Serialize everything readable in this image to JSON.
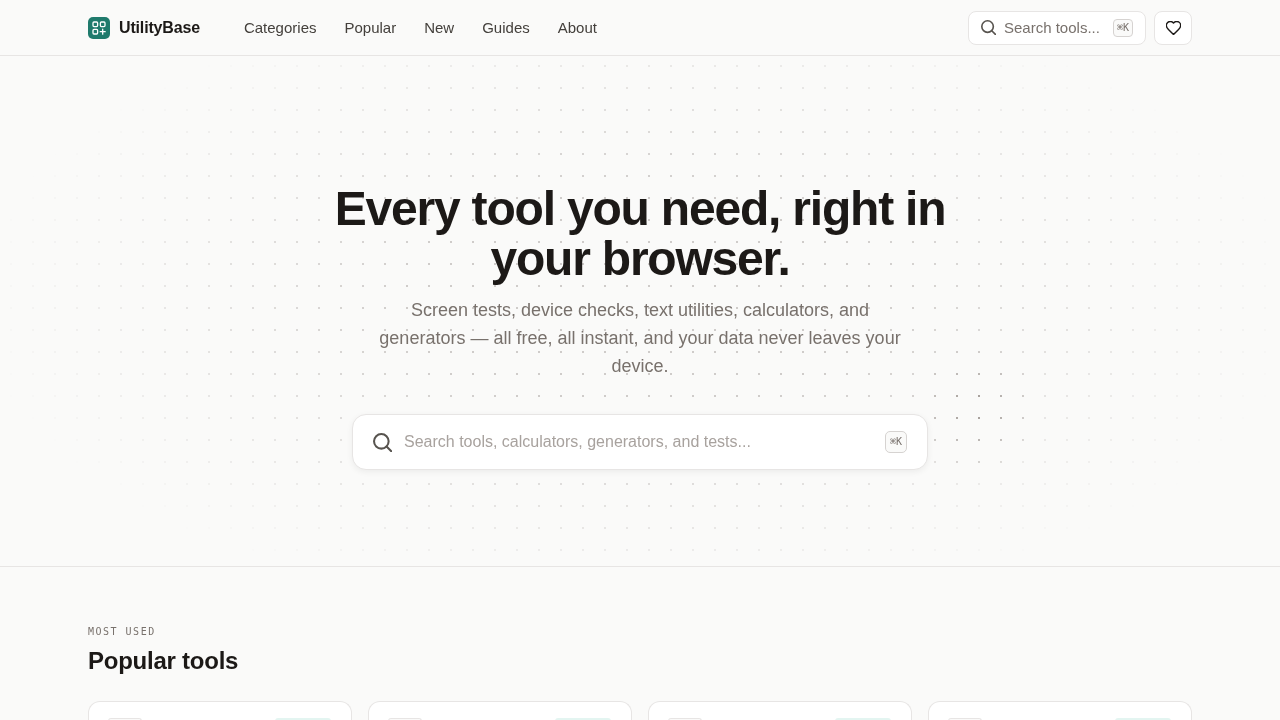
{
  "header": {
    "brand": "UtilityBase",
    "nav": [
      "Categories",
      "Popular",
      "New",
      "Guides",
      "About"
    ],
    "search": {
      "label": "Search tools...",
      "shortcut": "⌘K"
    }
  },
  "hero": {
    "title": "Every tool you need, right in your browser.",
    "subtitle": "Screen tests, device checks, text utilities, calculators, and generators — all free, all instant, and your data never leaves your device.",
    "search": {
      "placeholder": "Search tools, calculators, generators, and tests...",
      "shortcut": "⌘K"
    }
  },
  "popular": {
    "eyebrow": "MOST USED",
    "title": "Popular tools",
    "cards": [
      {
        "kind": "tool"
      },
      {
        "kind": "tool"
      },
      {
        "kind": "tool"
      },
      {
        "kind": "tool"
      }
    ]
  }
}
